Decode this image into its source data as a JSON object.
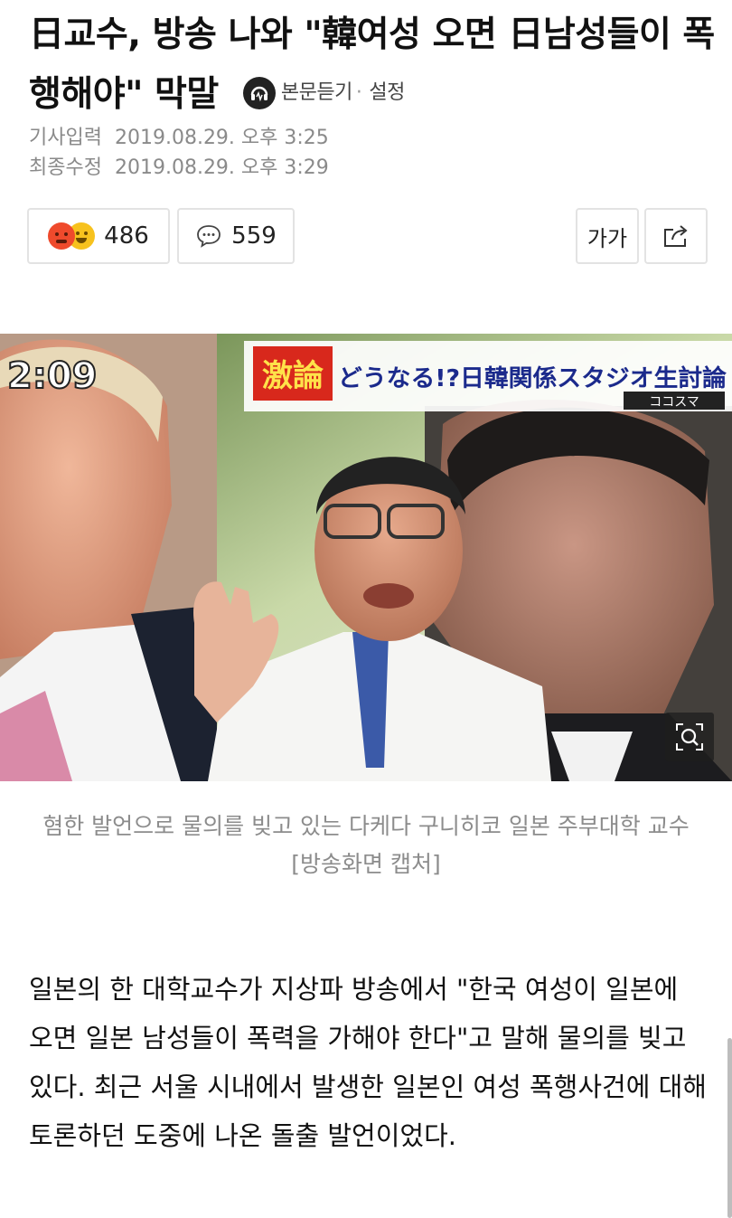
{
  "article": {
    "title": "日교수, 방송 나와 \"韓여성 오면 日남성들이 폭행해야\" 막말",
    "tts_label": "본문듣기",
    "settings_label": "설정",
    "published_label": "기사입력",
    "published_value": "2019.08.29. 오후 3:25",
    "modified_label": "최종수정",
    "modified_value": "2019.08.29. 오후 3:29"
  },
  "actions": {
    "reaction_count": "486",
    "comment_count": "559",
    "font_size_label": "가가"
  },
  "image": {
    "timestamp": "2:09",
    "headline_left": "激論",
    "headline_right": "どうなる!?日韓関係スタジオ生討論",
    "show_name": "ココスマ",
    "caption": "혐한 발언으로 물의를 빚고 있는 다케다 구니히코 일본 주부대학 교수 [방송화면 캡처]"
  },
  "body": {
    "paragraph": "일본의 한 대학교수가 지상파 방송에서 \"한국 여성이 일본에 오면 일본 남성들이 폭력을 가해야 한다\"고 말해 물의를 빚고 있다. 최근 서울 시내에서 발생한 일본인 여성 폭행사건에 대해 토론하던 도중에 나온 돌출 발언이었다."
  },
  "icons": {
    "tts": "headphone-speaker-icon",
    "comment": "speech-bubble-icon",
    "share": "share-icon",
    "zoom": "magnifier-icon"
  },
  "colors": {
    "reaction_red": "#ef4a2c",
    "reaction_yellow": "#f7c21e",
    "banner_red": "#d8281c",
    "banner_blue": "#1b2a8c"
  }
}
